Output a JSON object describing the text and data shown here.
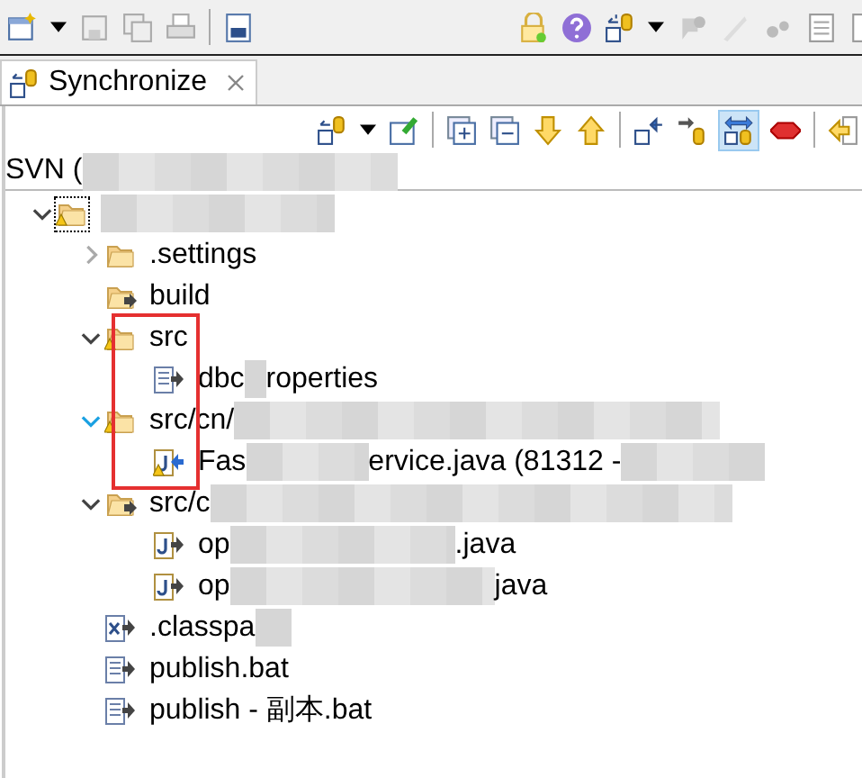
{
  "tab": {
    "label": "Synchronize",
    "selected": true
  },
  "header": "SVN (",
  "tree": [
    {
      "kind": "project",
      "expanded": true,
      "focused": true,
      "children": [
        {
          "kind": "folder",
          "parts": [
            ".settings"
          ],
          "expanded": false
        },
        {
          "kind": "folder-out",
          "parts": [
            "build"
          ]
        },
        {
          "kind": "folder-warn",
          "parts": [
            "src"
          ],
          "expanded": true,
          "children": [
            {
              "kind": "file-out",
              "parts": [
                "dbc",
                "roperties"
              ]
            }
          ]
        },
        {
          "kind": "folder-warn",
          "parts": [
            "src/cn/"
          ],
          "expanded": true,
          "hot": true,
          "children": [
            {
              "kind": "java-in-warn",
              "parts": [
                "Fas",
                "ervice.java (81312 -"
              ]
            }
          ]
        },
        {
          "kind": "folder-out",
          "parts": [
            "src/c"
          ],
          "expanded": true,
          "children": [
            {
              "kind": "java-out",
              "parts": [
                "op",
                ".java"
              ]
            },
            {
              "kind": "java-out",
              "parts": [
                "op",
                "java"
              ]
            }
          ]
        },
        {
          "kind": "xml-out",
          "parts": [
            ".classpa"
          ]
        },
        {
          "kind": "file-out",
          "parts": [
            "publish.bat"
          ]
        },
        {
          "kind": "file-out",
          "parts": [
            "publish - 副本.bat"
          ]
        }
      ]
    }
  ]
}
